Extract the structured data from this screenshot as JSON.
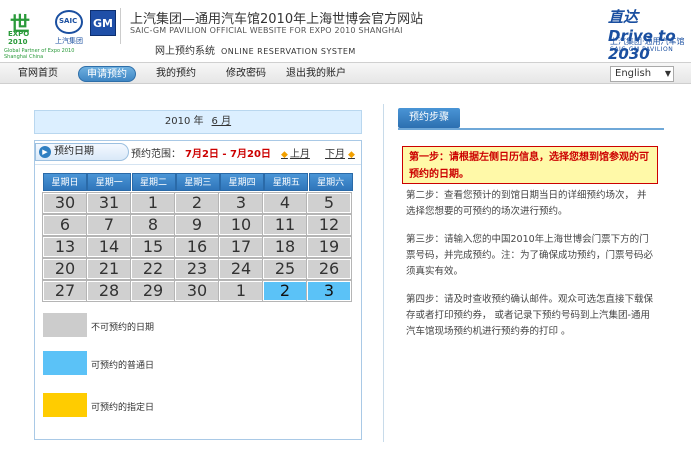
{
  "header": {
    "expo_logo_symbol": "世",
    "expo_logo_text": "EXPO 2010",
    "expo_small_text": "Global Partner of Expo 2010 Shanghai China",
    "saic_logo_text": "SAIC",
    "saic_logo_cn": "上汽集团",
    "gm_logo_text": "GM",
    "title_cn": "上汽集团—通用汽车馆2010年上海世博会官方网站",
    "title_en": "SAIC-GM PAVILION OFFICIAL WEBSITE FOR EXPO 2010 SHANGHAI",
    "subtitle_cn": "网上预约系统",
    "subtitle_en": "ONLINE  RESERVATION SYSTEM",
    "brand_big": "直达 Drive to 2030",
    "brand_cn": "上汽集团·通用汽车馆",
    "brand_en": "SAIC-GM PAVILION"
  },
  "nav": {
    "items": [
      {
        "label": "官网首页"
      },
      {
        "label": "申请预约"
      },
      {
        "label": "我的预约"
      },
      {
        "label": "修改密码"
      },
      {
        "label": "退出我的账户"
      }
    ],
    "language": "English"
  },
  "calendar": {
    "year_label": "2010 年",
    "month_label": "6 月",
    "tab_label": "预约日期",
    "range_prefix": "预约范围：",
    "range_value": "7月2日 - 7月20日",
    "prev_label": "上月",
    "next_label": "下月",
    "weekdays": [
      "星期日",
      "星期一",
      "星期二",
      "星期三",
      "星期四",
      "星期五",
      "星期六"
    ],
    "weeks": [
      [
        {
          "d": "30",
          "s": "unavailable"
        },
        {
          "d": "31",
          "s": "unavailable"
        },
        {
          "d": "1",
          "s": "unavailable"
        },
        {
          "d": "2",
          "s": "unavailable"
        },
        {
          "d": "3",
          "s": "unavailable"
        },
        {
          "d": "4",
          "s": "unavailable"
        },
        {
          "d": "5",
          "s": "unavailable"
        }
      ],
      [
        {
          "d": "6",
          "s": "unavailable"
        },
        {
          "d": "7",
          "s": "unavailable"
        },
        {
          "d": "8",
          "s": "unavailable"
        },
        {
          "d": "9",
          "s": "unavailable"
        },
        {
          "d": "10",
          "s": "unavailable"
        },
        {
          "d": "11",
          "s": "unavailable"
        },
        {
          "d": "12",
          "s": "unavailable"
        }
      ],
      [
        {
          "d": "13",
          "s": "unavailable"
        },
        {
          "d": "14",
          "s": "unavailable"
        },
        {
          "d": "15",
          "s": "unavailable"
        },
        {
          "d": "16",
          "s": "unavailable"
        },
        {
          "d": "17",
          "s": "unavailable"
        },
        {
          "d": "18",
          "s": "unavailable"
        },
        {
          "d": "19",
          "s": "unavailable"
        }
      ],
      [
        {
          "d": "20",
          "s": "unavailable"
        },
        {
          "d": "21",
          "s": "unavailable"
        },
        {
          "d": "22",
          "s": "unavailable"
        },
        {
          "d": "23",
          "s": "unavailable"
        },
        {
          "d": "24",
          "s": "unavailable"
        },
        {
          "d": "25",
          "s": "unavailable"
        },
        {
          "d": "26",
          "s": "unavailable"
        }
      ],
      [
        {
          "d": "27",
          "s": "unavailable"
        },
        {
          "d": "28",
          "s": "unavailable"
        },
        {
          "d": "29",
          "s": "unavailable"
        },
        {
          "d": "30",
          "s": "unavailable"
        },
        {
          "d": "1",
          "s": "unavailable"
        },
        {
          "d": "2",
          "s": "available"
        },
        {
          "d": "3",
          "s": "available"
        }
      ]
    ],
    "legend": [
      {
        "label": "不可预约的日期",
        "color": "#cccccc"
      },
      {
        "label": "可预约的普通日",
        "color": "#5bc2f7"
      },
      {
        "label": "可预约的指定日",
        "color": "#ffcc00"
      }
    ]
  },
  "steps": {
    "tab_label": "预约步骤",
    "step1": "第一步：请根据左侧日历信息，选择您想到馆参观的可预约的日期。",
    "step2": "第二步：查看您预计的到馆日期当日的详细预约场次， 并选择您想要的可预约的场次进行预约。",
    "step3": "第三步：请输入您的中国2010年上海世博会门票下方的门票号码，并完成预约。注：为了确保成功预约，门票号码必须真实有效。",
    "step4": "第四步：请及时查收预约确认邮件。观众可选怎直接下载保存或者打印预约券， 或者记录下预约号码到上汽集团-通用汽车馆现场预约机进行预约券的打印 。"
  }
}
